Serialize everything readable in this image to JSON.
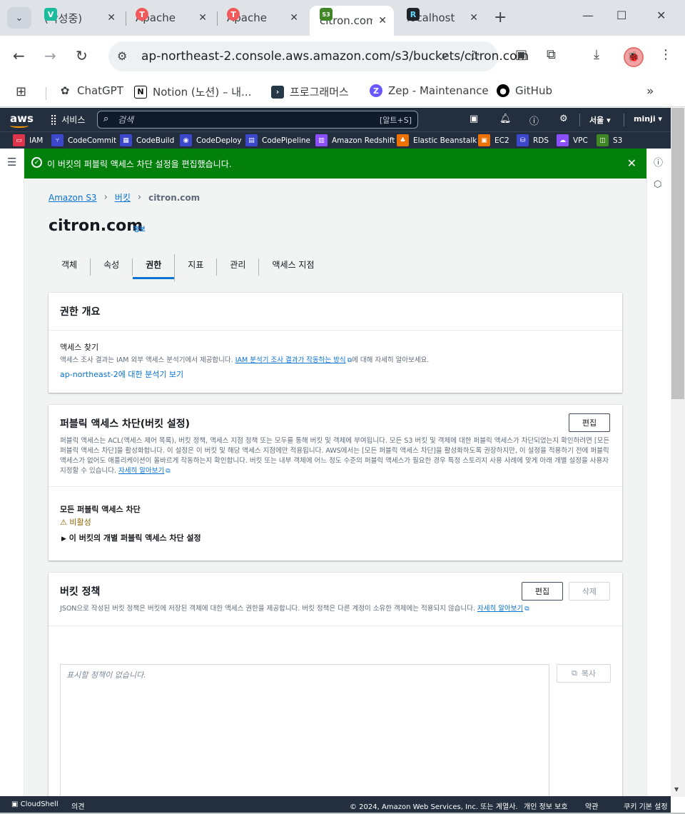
{
  "browser": {
    "tabs": [
      {
        "title": "(작성중)",
        "icon": "V",
        "color": "#1bbc9b"
      },
      {
        "title": "Apache",
        "icon": "T",
        "color": "#f05a5a"
      },
      {
        "title": "Apache",
        "icon": "T",
        "color": "#f05a5a"
      },
      {
        "title": "citron.com",
        "icon": "S3",
        "color": "#3f8624",
        "active": true
      },
      {
        "title": "localhost",
        "icon": "R",
        "color": "#20232a"
      }
    ],
    "url": "ap-northeast-2.console.aws.amazon.com/s3/buckets/citron.com",
    "bookmarks": [
      {
        "label": "ChatGPT",
        "icon": "chatgpt-icon"
      },
      {
        "label": "Notion (노션) – 내...",
        "icon": "notion-icon"
      },
      {
        "label": "프로그래머스",
        "icon": "programmers-icon"
      },
      {
        "label": "Zep - Maintenance",
        "icon": "zep-icon"
      },
      {
        "label": "GitHub",
        "icon": "github-icon"
      }
    ]
  },
  "aws": {
    "logo": "aws",
    "services_label": "서비스",
    "search_placeholder": "검색",
    "search_shortcut": "[알트+S]",
    "region": "서울 ▾",
    "user": "minji ▾",
    "favorites": [
      {
        "label": "IAM",
        "color": "#dd344c"
      },
      {
        "label": "CodeCommit",
        "color": "#3b48cc"
      },
      {
        "label": "CodeBuild",
        "color": "#3b48cc"
      },
      {
        "label": "CodeDeploy",
        "color": "#3b48cc"
      },
      {
        "label": "CodePipeline",
        "color": "#3b48cc"
      },
      {
        "label": "Amazon Redshift",
        "color": "#8c4fff"
      },
      {
        "label": "Elastic Beanstalk",
        "color": "#ed7100"
      },
      {
        "label": "EC2",
        "color": "#ed7100"
      },
      {
        "label": "RDS",
        "color": "#3b48cc"
      },
      {
        "label": "VPC",
        "color": "#8c4fff"
      },
      {
        "label": "S3",
        "color": "#3f8624"
      }
    ]
  },
  "flash": {
    "message": "이 버킷의 퍼블릭 액세스 차단 설정을 편집했습니다."
  },
  "breadcrumbs": {
    "root": "Amazon S3",
    "buckets": "버킷",
    "current": "citron.com"
  },
  "page": {
    "title": "citron.com",
    "info": "정보"
  },
  "tabs": [
    "객체",
    "속성",
    "권한",
    "지표",
    "관리",
    "액세스 지점"
  ],
  "overview": {
    "title": "권한 개요",
    "access_label": "액세스 찾기",
    "desc_prefix": "액세스 조사 결과는 IAM 외부 액세스 분석기에서 제공합니다. ",
    "desc_link": "IAM 분석기 조사 결과가 작동하는 방식",
    "desc_suffix": "에 대해 자세히 알아보세요.",
    "analyzer_link": "ap-northeast-2에 대한 분석기 보기"
  },
  "public_access": {
    "title": "퍼블릭 액세스 차단(버킷 설정)",
    "edit": "편집",
    "desc": "퍼블릭 액세스는 ACL(액세스 제어 목록), 버킷 정책, 액세스 지점 정책 또는 모두를 통해 버킷 및 객체에 부여됩니다. 모든 S3 버킷 및 객체에 대한 퍼블릭 액세스가 차단되었는지 확인하려면 [모든 퍼블릭 액세스 차단]을 활성화합니다. 이 설정은 이 버킷 및 해당 액세스 지점에만 적용됩니다. AWS에서는 [모든 퍼블릭 액세스 차단]을 활성화하도록 권장하지만, 이 설정을 적용하기 전에 퍼블릭 액세스가 없어도 애플리케이션이 올바르게 작동하는지 확인합니다. 버킷 또는 내부 객체에 어느 정도 수준의 퍼블릭 액세스가 필요한 경우 특정 스토리지 사용 사례에 맞게 아래 개별 설정을 사용자 지정할 수 있습니다. ",
    "learn_more": "자세히 알아보기",
    "block_all": "모든 퍼블릭 액세스 차단",
    "status": "비활성",
    "expand": "이 버킷의 개별 퍼블릭 액세스 차단 설정"
  },
  "bucket_policy": {
    "title": "버킷 정책",
    "edit": "편집",
    "delete": "삭제",
    "desc": "JSON으로 작성된 버킷 정책은 버킷에 저장된 객체에 대한 액세스 권한을 제공합니다. 버킷 정책은 다른 계정이 소유한 객체에는 적용되지 않습니다. ",
    "learn_more": "자세히 알아보기",
    "empty": "표시할 정책이 없습니다.",
    "copy": "복사"
  },
  "footer": {
    "cloudshell": "CloudShell",
    "feedback": "의견",
    "copyright": "© 2024, Amazon Web Services, Inc. 또는 계열사.",
    "privacy": "개인 정보 보호",
    "terms": "약관",
    "cookies": "쿠키 기본 설정"
  }
}
